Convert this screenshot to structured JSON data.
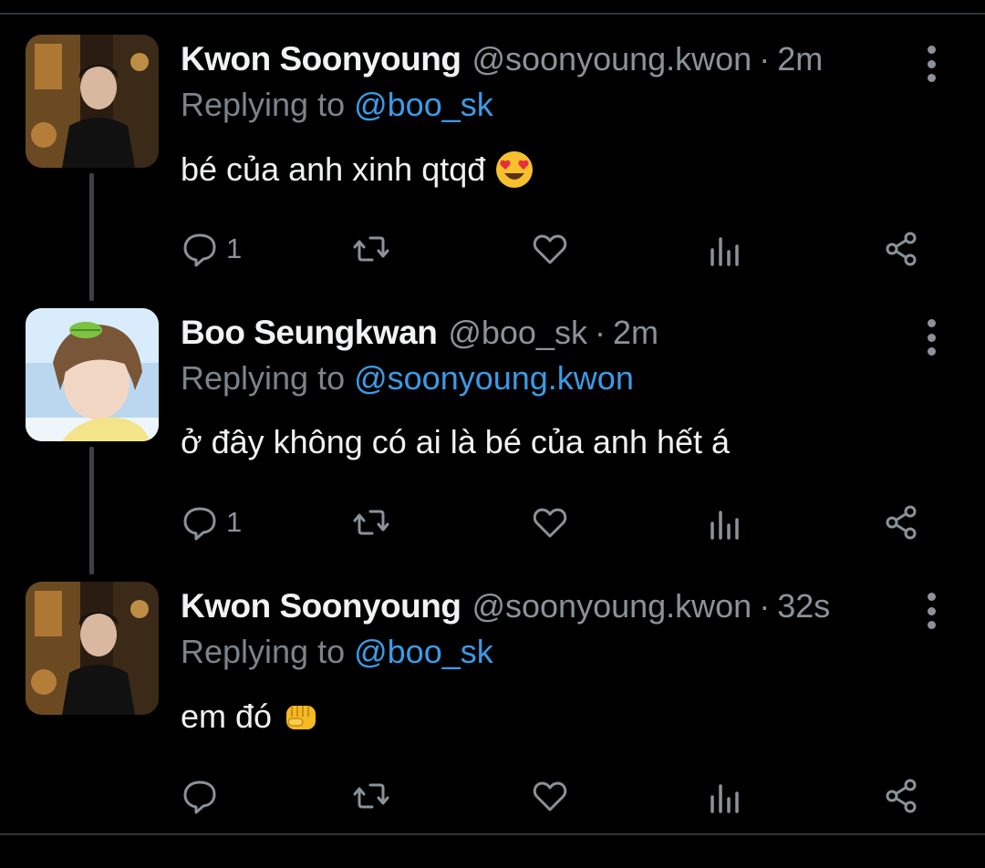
{
  "tweets": [
    {
      "name": "Kwon Soonyoung",
      "handle": "@soonyoung.kwon",
      "time": "2m",
      "replying_prefix": "Replying to ",
      "replying_to": "@boo_sk",
      "text": "bé của anh xinh qtqđ",
      "emoji": "heart-eyes-emoji",
      "reply_count": "1"
    },
    {
      "name": "Boo Seungkwan",
      "handle": "@boo_sk",
      "time": "2m",
      "replying_prefix": "Replying to ",
      "replying_to": "@soonyoung.kwon",
      "text": "ở đây không có ai là bé của anh hết á",
      "emoji": "",
      "reply_count": "1"
    },
    {
      "name": "Kwon Soonyoung",
      "handle": "@soonyoung.kwon",
      "time": "32s",
      "replying_prefix": "Replying to ",
      "replying_to": "@boo_sk",
      "text": "em đó",
      "emoji": "fist-emoji",
      "reply_count": ""
    }
  ],
  "separator": "·",
  "colors": {
    "background": "#000000",
    "text": "#e7e9ea",
    "secondary": "#8b9299",
    "mention": "#3c9be6",
    "divider": "#2f3336",
    "thread_line": "#3e4144"
  }
}
